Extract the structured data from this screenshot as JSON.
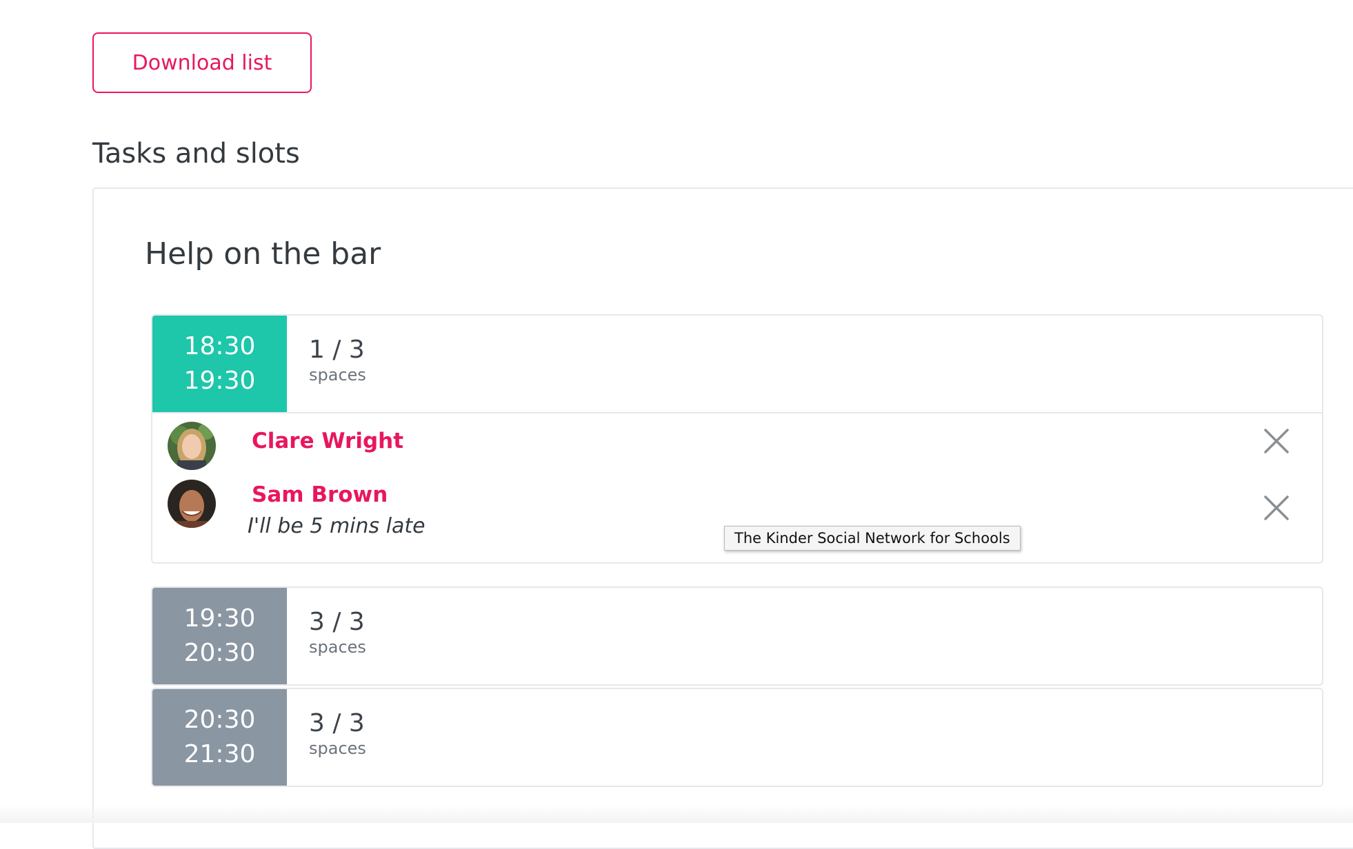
{
  "toolbar": {
    "download_label": "Download list"
  },
  "section": {
    "title": "Tasks and slots"
  },
  "task": {
    "title": "Help on the bar",
    "slots": [
      {
        "start": "18:30",
        "end": "19:30",
        "count": "1 / 3",
        "spaces_label": "spaces",
        "status": "open",
        "people": [
          {
            "name": "Clare Wright",
            "note": ""
          },
          {
            "name": "Sam Brown",
            "note": "I'll be 5 mins late"
          }
        ]
      },
      {
        "start": "19:30",
        "end": "20:30",
        "count": "3 / 3",
        "spaces_label": "spaces",
        "status": "full"
      },
      {
        "start": "20:30",
        "end": "21:30",
        "count": "3 / 3",
        "spaces_label": "spaces",
        "status": "full"
      }
    ]
  },
  "tooltip": {
    "text": "The Kinder Social Network for Schools"
  },
  "icons": {
    "remove": "close-icon",
    "avatar": "avatar"
  },
  "colors": {
    "accent": "#e8175d",
    "open_slot": "#1ec6aa",
    "full_slot": "#8a96a2"
  }
}
